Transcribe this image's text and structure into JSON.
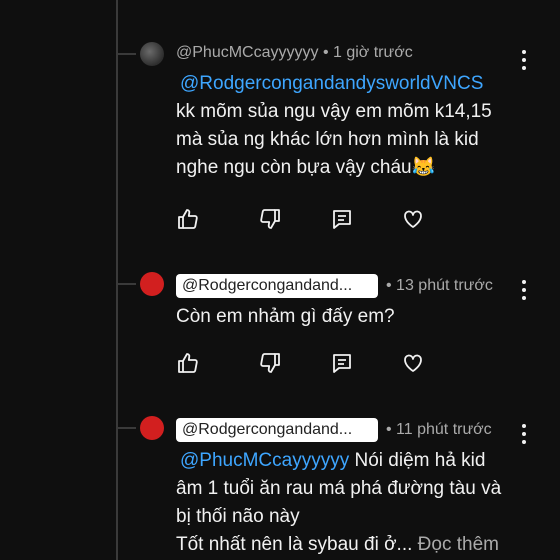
{
  "comments": [
    {
      "author": "@PhucMCcayyyyyy",
      "time": "1 giờ trước",
      "mention": "@RodgercongandandysworldVNCS",
      "lines": [
        "kk mõm sủa ngu vậy em mõm k14,15",
        "mà sủa ng khác lớn hơn mình là kid",
        "nghe ngu còn bựa vậy cháu😹"
      ]
    },
    {
      "author_chip": "@Rodgercongandand...",
      "time": "13 phút trước",
      "lines": [
        "Còn em nhảm gì đấy em?"
      ]
    },
    {
      "author_chip": "@Rodgercongandand...",
      "time": "11 phút trước",
      "mention": "@PhucMCcayyyyyy",
      "first_line_rest": "Nói diệm hả kid",
      "lines": [
        "âm 1 tuổi ăn rau má phá đường tàu và",
        "bị thối não này"
      ],
      "last_line": "Tốt nhất nên là sybau đi ở...",
      "read_more": "Đọc thêm"
    }
  ],
  "icons": {
    "like": "thumbs-up-icon",
    "dislike": "thumbs-down-icon",
    "reply": "reply-comment-icon",
    "heart": "heart-icon",
    "menu": "more-vert-icon"
  },
  "colors": {
    "background": "#0f0f0f",
    "mention": "#3ea6ff",
    "meta": "#aaaaaa",
    "text": "#f1f1f1"
  }
}
